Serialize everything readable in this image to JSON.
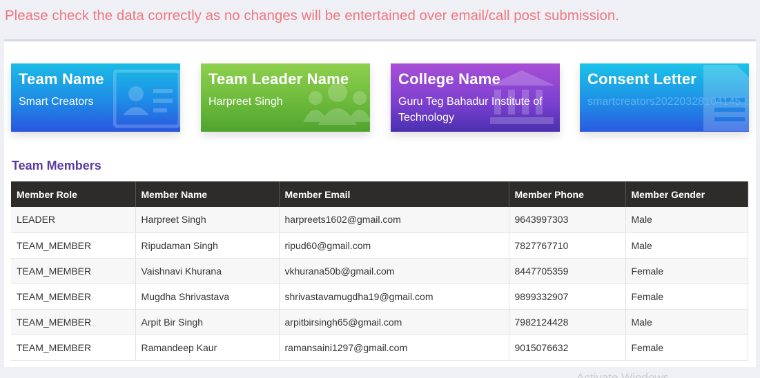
{
  "notice": "Please check the data correctly as no changes will be entertained over email/call post submission.",
  "cards": [
    {
      "title": "Team Name",
      "value": "Smart Creators",
      "icon": "id-card-icon",
      "color": "#1e8be6"
    },
    {
      "title": "Team Leader Name",
      "value": "Harpreet Singh",
      "icon": "users-icon",
      "color": "#6ab83a"
    },
    {
      "title": "College Name",
      "value": "Guru Teg Bahadur Institute of Technology",
      "icon": "institution-icon",
      "color": "#7a3fcf"
    },
    {
      "title": "Consent Letter",
      "value": "smartcreators20220328104145.pdf",
      "icon": "document-icon",
      "color": "#1e90e6"
    }
  ],
  "members_title": "Team Members",
  "table": {
    "headers": [
      "Member Role",
      "Member Name",
      "Member Email",
      "Member Phone",
      "Member Gender"
    ],
    "rows": [
      [
        "LEADER",
        "Harpreet Singh",
        "harpreets1602@gmail.com",
        "9643997303",
        "Male"
      ],
      [
        "TEAM_MEMBER",
        "Ripudaman Singh",
        "ripud60@gmail.com",
        "7827767710",
        "Male"
      ],
      [
        "TEAM_MEMBER",
        "Vaishnavi Khurana",
        "vkhurana50b@gmail.com",
        "8447705359",
        "Female"
      ],
      [
        "TEAM_MEMBER",
        "Mugdha Shrivastava",
        "shrivastavamugdha19@gmail.com",
        "9899332907",
        "Female"
      ],
      [
        "TEAM_MEMBER",
        "Arpit Bir Singh",
        "arpitbirsingh65@gmail.com",
        "7982124428",
        "Male"
      ],
      [
        "TEAM_MEMBER",
        "Ramandeep Kaur",
        "ramansaini1297@gmail.com",
        "9015076632",
        "Female"
      ]
    ]
  },
  "watermark": "Activate Windows"
}
